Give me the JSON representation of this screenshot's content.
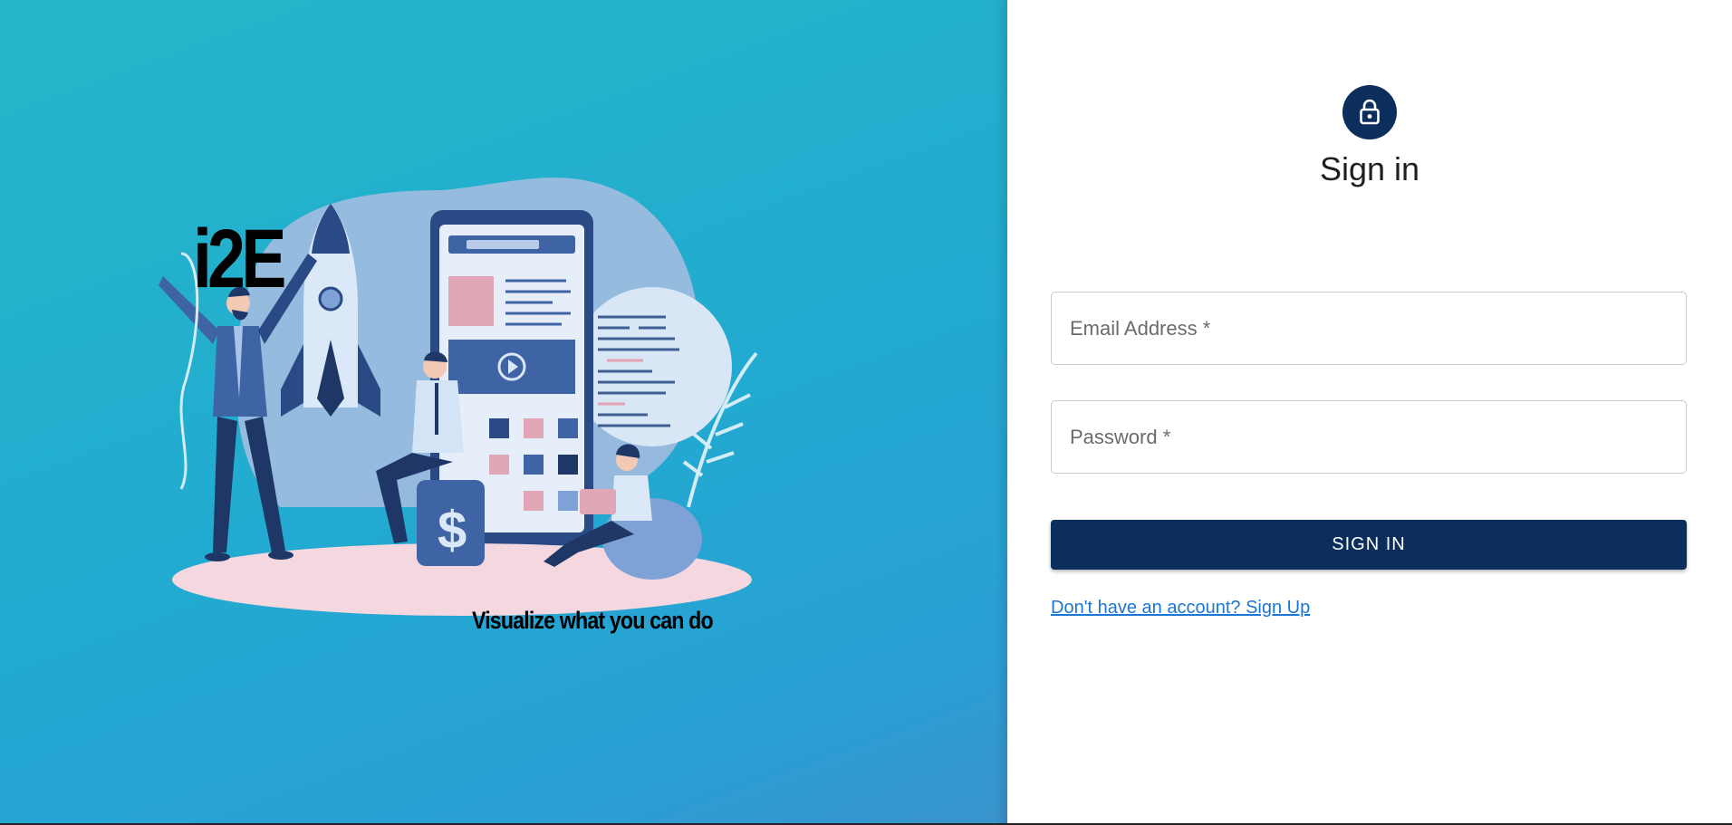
{
  "brand": {
    "logo_text": "i2E",
    "tagline": "Visualize what you can do"
  },
  "signin": {
    "title": "Sign in",
    "email_placeholder": "Email Address *",
    "password_placeholder": "Password *",
    "submit_label": "SIGN IN",
    "signup_link": "Don't have an account? Sign Up"
  },
  "icons": {
    "avatar": "lock-icon"
  },
  "colors": {
    "primary": "#0b2e5c",
    "link": "#1976d2",
    "left_gradient_start": "#24b7c8",
    "left_gradient_end": "#2a9fd6"
  }
}
